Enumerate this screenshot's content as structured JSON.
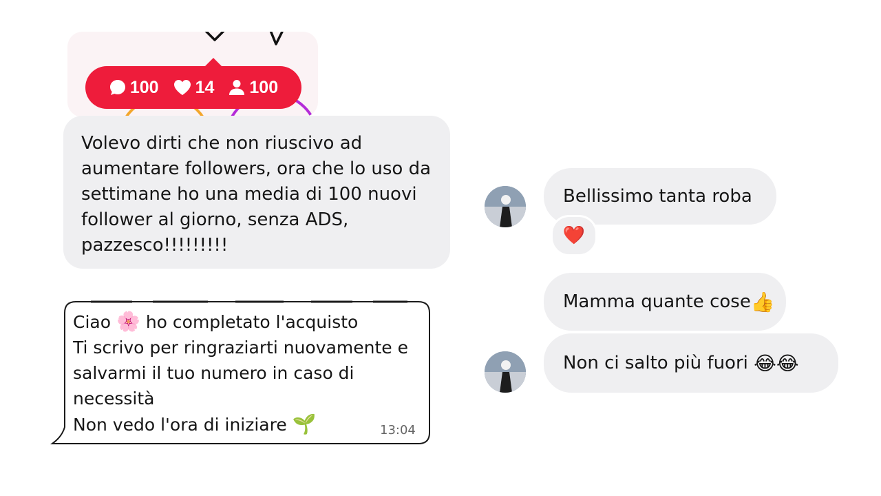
{
  "notification": {
    "comments": "100",
    "likes": "14",
    "followers": "100"
  },
  "left_message": {
    "lines": [
      "Volevo dirti che non riuscivo ad",
      "aumentare followers, ora che lo uso da",
      "settimane ho una media di 100 nuovi",
      "follower al giorno, senza ADS,",
      "pazzesco!!!!!!!!!"
    ]
  },
  "whatsapp_message": {
    "line1_a": "Ciao",
    "line1_emoji": "🌸",
    "line1_b": "ho completato l'acquisto",
    "line2": "Ti scrivo per ringraziarti nuovamente e",
    "line3": "salvarmi il tuo numero in caso di",
    "line4": "necessità",
    "line5_a": "Non vedo l'ora di iniziare",
    "line5_emoji": "🌱",
    "time": "13:04"
  },
  "right_chat": {
    "msg1": "Bellissimo tanta roba",
    "msg1_reaction": "❤️",
    "msg2": "Mamma quante cose",
    "msg2_emoji": "👍",
    "msg3": "Non ci salto più fuori",
    "msg3_emoji": "😂😂"
  },
  "colors": {
    "notification_red": "#ee1c3b",
    "bubble_gray": "#efeff1"
  }
}
